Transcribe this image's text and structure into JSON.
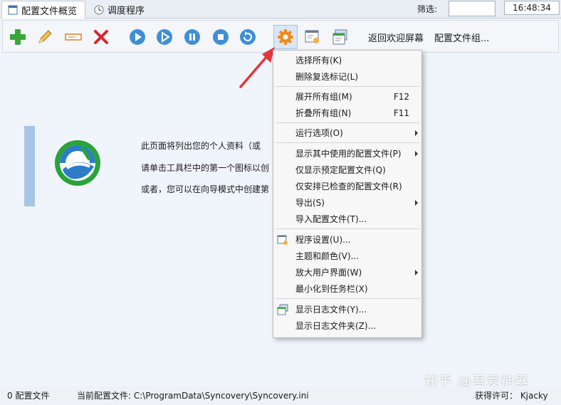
{
  "tabs": [
    {
      "label": "配置文件概览",
      "icon": "profile-window-icon",
      "active": true
    },
    {
      "label": "调度程序",
      "icon": "clock-icon",
      "active": false
    }
  ],
  "filter": {
    "label": "筛选:",
    "value": ""
  },
  "clock": {
    "time": "16:48:34"
  },
  "toolbar": {
    "buttons": [
      {
        "name": "add-profile-button",
        "icon": "plus-icon"
      },
      {
        "name": "edit-profile-button",
        "icon": "pencil-icon"
      },
      {
        "name": "rename-profile-button",
        "icon": "rename-icon"
      },
      {
        "name": "delete-profile-button",
        "icon": "delete-x-icon"
      },
      {
        "name": "run-button",
        "icon": "play-icon"
      },
      {
        "name": "run-attended-button",
        "icon": "play-outline-icon"
      },
      {
        "name": "pause-button",
        "icon": "pause-icon"
      },
      {
        "name": "stop-button",
        "icon": "stop-icon"
      },
      {
        "name": "refresh-button",
        "icon": "refresh-icon"
      },
      {
        "name": "settings-button",
        "icon": "gear-icon"
      },
      {
        "name": "program-settings-button",
        "icon": "settings-window-icon"
      },
      {
        "name": "log-button",
        "icon": "log-window-icon"
      }
    ],
    "welcome_label": "返回欢迎屏幕",
    "profile_group_label": "配置文件组..."
  },
  "intro": {
    "line1": "此页面将列出您的个人资料（或",
    "line2": "请单击工具栏中的第一个图标以创",
    "line3": "或者，您可以在向导模式中创建第"
  },
  "menu": {
    "items": [
      {
        "label": "选择所有(K)",
        "shortcut": "",
        "submenu": false,
        "icon": ""
      },
      {
        "label": "删除复选标记(L)",
        "shortcut": "",
        "submenu": false,
        "icon": ""
      },
      {
        "label": "展开所有组(M)",
        "shortcut": "F12",
        "submenu": false,
        "icon": ""
      },
      {
        "label": "折叠所有组(N)",
        "shortcut": "F11",
        "submenu": false,
        "icon": ""
      },
      {
        "label": "运行选项(O)",
        "shortcut": "",
        "submenu": true,
        "icon": ""
      },
      {
        "label": "显示其中使用的配置文件(P)",
        "shortcut": "",
        "submenu": true,
        "icon": ""
      },
      {
        "label": "仅显示预定配置文件(Q)",
        "shortcut": "",
        "submenu": false,
        "icon": ""
      },
      {
        "label": "仅安排已检查的配置文件(R)",
        "shortcut": "",
        "submenu": false,
        "icon": ""
      },
      {
        "label": "导出(S)",
        "shortcut": "",
        "submenu": true,
        "icon": ""
      },
      {
        "label": "导入配置文件(T)...",
        "shortcut": "",
        "submenu": false,
        "icon": ""
      },
      {
        "label": "程序设置(U)...",
        "shortcut": "",
        "submenu": false,
        "icon": "settings-window-icon"
      },
      {
        "label": "主题和颜色(V)...",
        "shortcut": "",
        "submenu": false,
        "icon": ""
      },
      {
        "label": "放大用户界面(W)",
        "shortcut": "",
        "submenu": true,
        "icon": ""
      },
      {
        "label": "最小化到任务栏(X)",
        "shortcut": "",
        "submenu": false,
        "icon": ""
      },
      {
        "label": "显示日志文件(Y)...",
        "shortcut": "",
        "submenu": false,
        "icon": "log-window-icon"
      },
      {
        "label": "显示日志文件夹(Z)...",
        "shortcut": "",
        "submenu": false,
        "icon": ""
      }
    ]
  },
  "status": {
    "profile_count": "0 配置文件",
    "current_config": "当前配置文件: C:\\ProgramData\\Syncovery\\Syncovery.ini",
    "license": "获得许可： Kjacky"
  },
  "watermark": "知乎 @吾爱神器",
  "colors": {
    "accent_blue": "#3f8fd6",
    "red_arrow": "#e2363a",
    "gear_orange": "#f08a1c",
    "plus_green": "#3aa63a",
    "delete_red": "#d9262c"
  }
}
